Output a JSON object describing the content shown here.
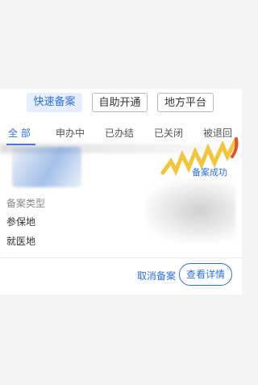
{
  "mode_tabs": [
    {
      "label": "快速备案"
    },
    {
      "label": "自助开通"
    },
    {
      "label": "地方平台"
    }
  ],
  "status_tabs": [
    {
      "label": "全 部"
    },
    {
      "label": "申办中"
    },
    {
      "label": "已办结"
    },
    {
      "label": "已关闭"
    },
    {
      "label": "被退回"
    }
  ],
  "record": {
    "status_badge": "备案成功",
    "type_label": "备案类型",
    "insured_place": "参保地",
    "medical_place": "就医地"
  },
  "actions": {
    "cancel_label": "取消备案",
    "detail_label": "查看详情"
  },
  "colors": {
    "accent": "#2f6fe0",
    "burst_yellow": "#f2c53a",
    "burst_red": "#e0502a"
  }
}
